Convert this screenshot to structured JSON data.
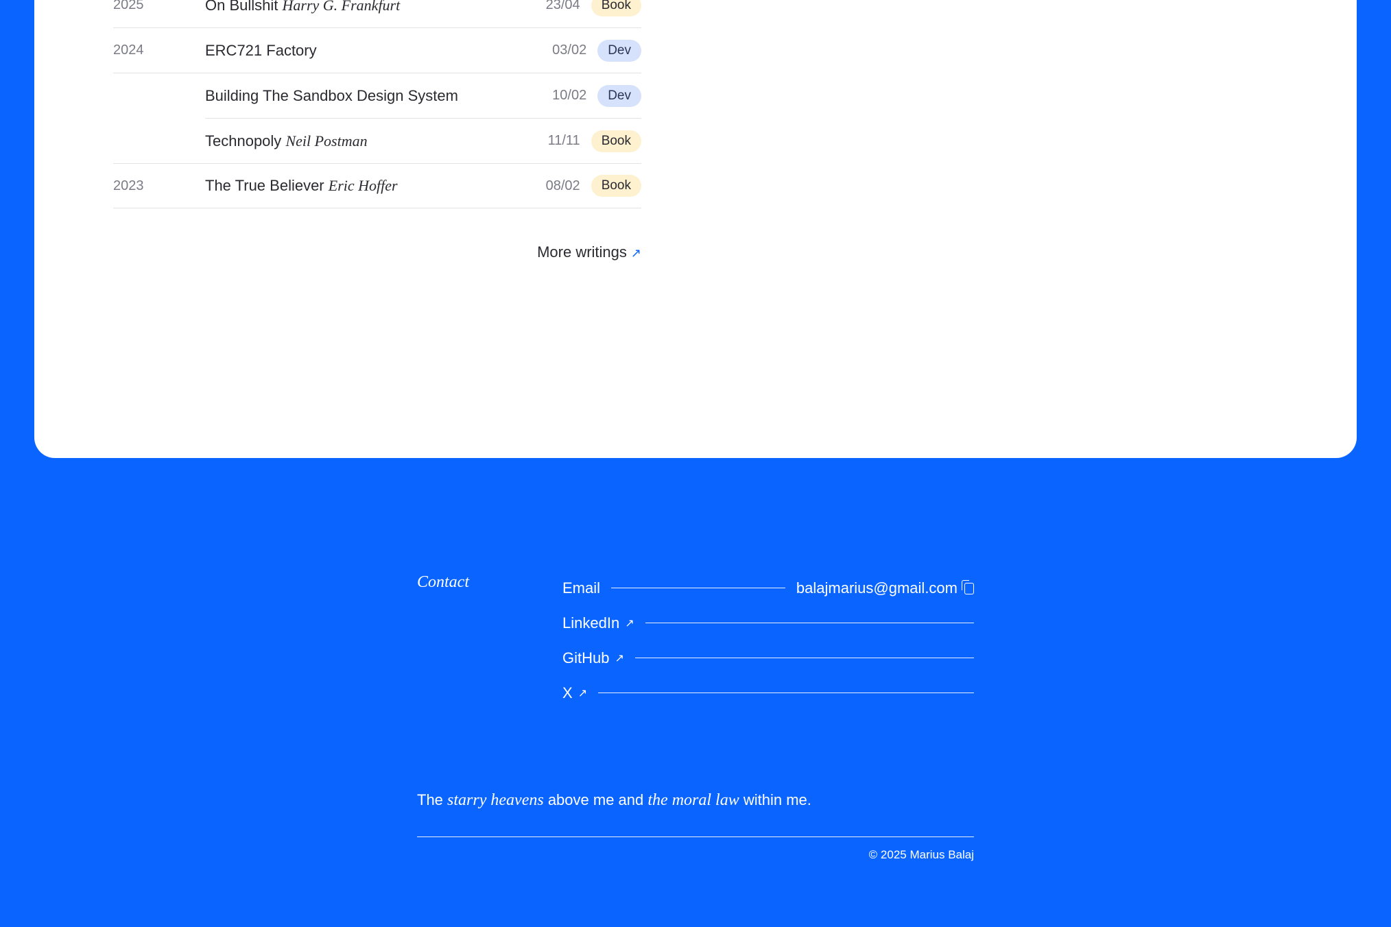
{
  "writings": [
    {
      "year": "2025",
      "title": "On Bullshit",
      "author": "Harry G. Frankfurt",
      "date": "23/04",
      "tag": "Book",
      "tag_kind": "book"
    },
    {
      "year": "2024",
      "title": "ERC721 Factory",
      "author": "",
      "date": "03/02",
      "tag": "Dev",
      "tag_kind": "dev"
    },
    {
      "year": "",
      "title": "Building The Sandbox Design System",
      "author": "",
      "date": "10/02",
      "tag": "Dev",
      "tag_kind": "dev"
    },
    {
      "year": "",
      "title": "Technopoly",
      "author": "Neil Postman",
      "date": "11/11",
      "tag": "Book",
      "tag_kind": "book"
    },
    {
      "year": "2023",
      "title": "The True Believer",
      "author": "Eric Hoffer",
      "date": "08/02",
      "tag": "Book",
      "tag_kind": "book"
    }
  ],
  "more_writings": {
    "label": "More writings",
    "icon": "arrow-up-right-icon"
  },
  "contact": {
    "label": "Contact",
    "email_label": "Email",
    "email_value": "balajmarius@gmail.com",
    "linkedin_label": "LinkedIn",
    "github_label": "GitHub",
    "x_label": "X"
  },
  "quote": {
    "part1": "The",
    "em1": "starry heavens",
    "part2": "above me and",
    "em2": "the moral law",
    "part3": "within me."
  },
  "copyright": "© 2025 Marius Balaj",
  "colors": {
    "background": "#0a64ff",
    "book_badge": "#fdf1cf",
    "dev_badge": "#d6e2fb"
  }
}
